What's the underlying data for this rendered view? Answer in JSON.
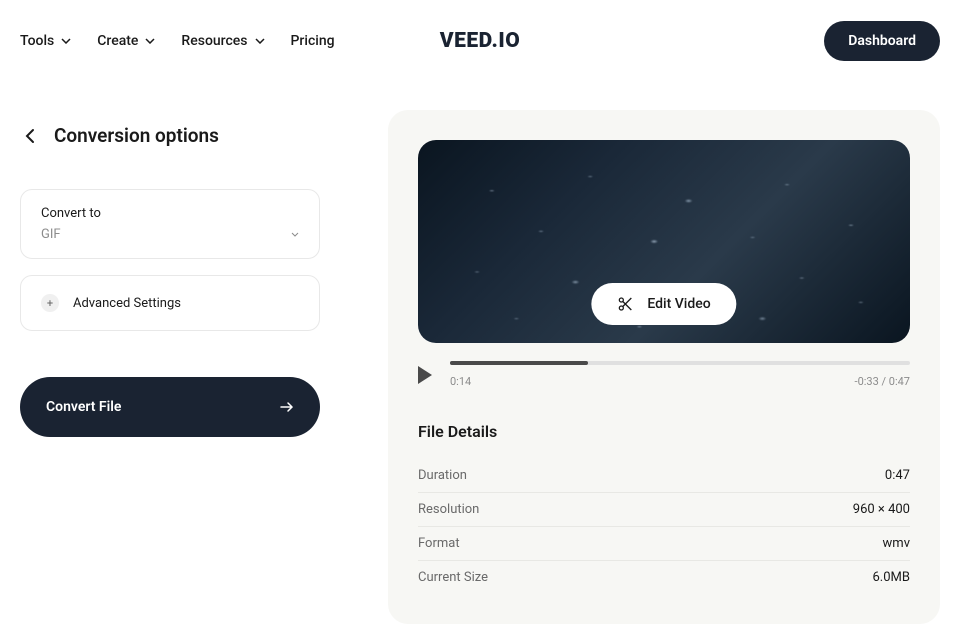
{
  "nav": {
    "items": [
      {
        "label": "Tools"
      },
      {
        "label": "Create"
      },
      {
        "label": "Resources"
      },
      {
        "label": "Pricing"
      }
    ]
  },
  "logo": "VEED.IO",
  "dashboard_label": "Dashboard",
  "panel": {
    "title": "Conversion options",
    "convert_to_label": "Convert to",
    "convert_to_value": "GIF",
    "advanced_label": "Advanced Settings",
    "convert_button": "Convert File"
  },
  "preview": {
    "edit_label": "Edit Video",
    "current_time": "0:14",
    "remaining_total": "-0:33 / 0:47"
  },
  "file_details": {
    "title": "File Details",
    "rows": [
      {
        "label": "Duration",
        "value": "0:47"
      },
      {
        "label": "Resolution",
        "value": "960 × 400"
      },
      {
        "label": "Format",
        "value": "wmv"
      },
      {
        "label": "Current Size",
        "value": "6.0MB"
      }
    ]
  }
}
